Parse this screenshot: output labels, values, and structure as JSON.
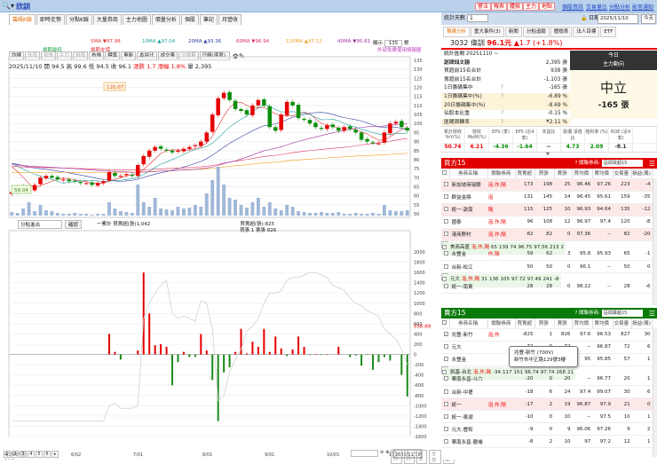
{
  "header": {
    "stock_name": "欣訓",
    "search_icon": "search-icon",
    "buttons": [
      "警法",
      "報表",
      "體檢",
      "主力",
      "地點"
    ],
    "links": [
      "個股資訊",
      "交易量比",
      "分點分析",
      "影音通知"
    ]
  },
  "left": {
    "tabs": [
      "籌碼K線",
      "即時走勢",
      "分點K線",
      "大量券商",
      "主力地圖",
      "價量分析",
      "個股",
      "筆記",
      "月營收"
    ],
    "ma": [
      {
        "label": "5MA ▼97.98",
        "color": "#e03030"
      },
      {
        "label": "10MA ▲97.04",
        "color": "#20a0a0"
      },
      {
        "label": "20MA ▲93.36",
        "color": "#3040a0"
      },
      {
        "label": "60MA ▼98.94",
        "color": "#e03060"
      },
      {
        "label": "120MA ▲97.12",
        "color": "#f0a020"
      },
      {
        "label": "40MA ▼95.61",
        "color": "#a030a0"
      }
    ],
    "ma2": [
      {
        "label": "楊期最低",
        "color": "#20a040"
      },
      {
        "label": "楊期支撐",
        "color": "#e03030"
      }
    ],
    "note": "外部免費使用情報圖",
    "toolbar": [
      "均線",
      "外資",
      "投信",
      "主力",
      "融資",
      "布林",
      "標準",
      "量能",
      "本益比",
      "成交量",
      "分價量"
    ],
    "toolbar_disabled": [
      1,
      2,
      3,
      4,
      10
    ],
    "period": "日線(還原)",
    "ohlc": {
      "date": "2025/11/10",
      "open": "開 94.5",
      "high": "高 99.6",
      "low": "低 94.5",
      "close": "收 96.1",
      "chg": "漲跌 1.7",
      "pct": "漲幅 1.8%",
      "vol": "量 2,395"
    },
    "zoom_label": "顯示",
    "zoom_value": "135",
    "zoom_unit": "根",
    "lower": {
      "select": "分點進出",
      "button": "確認",
      "cum_label": "一累計 買賣超(張)1,042",
      "net_label": "買賣超(張)-825",
      "bs_label": "買張 1 賣張 826",
      "last_value": "556.89"
    },
    "dates": [
      "4/28",
      "5/02",
      "6/02",
      "7/01",
      "8/01",
      "9/01",
      "10/01",
      "11/",
      "2025/11/10"
    ],
    "year": "2025",
    "pages": [
      "1",
      "2",
      "3",
      "4",
      "5",
      "6",
      "▸"
    ],
    "range_buttons": [
      "3月",
      "6月",
      "1年",
      "全部",
      "週期"
    ]
  },
  "chart_data": [
    {
      "type": "candlestick",
      "title": "",
      "ylim": [
        50,
        135
      ],
      "yticks": [
        50,
        55,
        60,
        65,
        70,
        75,
        80,
        85,
        90,
        95,
        100,
        105,
        110,
        115,
        120,
        125,
        130,
        135
      ],
      "annotations": {
        "max": "120.07",
        "min": "59.04"
      },
      "closes": [
        62,
        65,
        64,
        63,
        66,
        70,
        71,
        70,
        69,
        69,
        68,
        68,
        67,
        67,
        66,
        67,
        68,
        73,
        71,
        71,
        72,
        71,
        77,
        82,
        85,
        87,
        86,
        85,
        84,
        85,
        86,
        87,
        88,
        90,
        95,
        105,
        114,
        117,
        113,
        108,
        107,
        105,
        110,
        113,
        110,
        98,
        96,
        105,
        112,
        110,
        103,
        102,
        100,
        98,
        97,
        99,
        98,
        96,
        98,
        97,
        95,
        91,
        90,
        89,
        89,
        95,
        100,
        101,
        98,
        96.1
      ],
      "volume": [
        4,
        3,
        8,
        15,
        5,
        12,
        6,
        5,
        3,
        2,
        2,
        3,
        2,
        2,
        1,
        2,
        2,
        15,
        8,
        5,
        4,
        3,
        35,
        15,
        10,
        20,
        8,
        7,
        6,
        10,
        8,
        9,
        12,
        10,
        25,
        40,
        55,
        35,
        20,
        18,
        12,
        9,
        15,
        20,
        10,
        15,
        8,
        6,
        12,
        10,
        5,
        4,
        3,
        3,
        4,
        3,
        3,
        4,
        2,
        2,
        3,
        2,
        2,
        3,
        2,
        12,
        6,
        5,
        5,
        6
      ],
      "ma_periods": [
        5,
        10,
        20,
        60,
        120,
        40
      ]
    },
    {
      "type": "bar+line",
      "ylim": [
        -1600,
        2000
      ],
      "yticks": [
        -1600,
        -1400,
        -1200,
        -1000,
        -800,
        -600,
        -400,
        -200,
        0,
        200,
        400,
        600,
        800,
        1000,
        1200,
        1400,
        1600,
        1800,
        2000
      ],
      "net": [
        0,
        0,
        0,
        0,
        0,
        0,
        0,
        0,
        0,
        0,
        0,
        0,
        0,
        0,
        0,
        0,
        0,
        400,
        50,
        -100,
        0,
        0,
        80,
        1600,
        800,
        180,
        200,
        150,
        -600,
        -150,
        50,
        -50,
        -50,
        400,
        80,
        -500,
        -1300,
        -350,
        -250,
        50,
        500,
        20,
        250,
        150,
        500,
        50,
        350,
        120,
        -30,
        100,
        350,
        150,
        -10,
        10,
        -10,
        10,
        0,
        150,
        0,
        -50,
        -20,
        -220,
        -10,
        -300,
        -150,
        -50,
        -120,
        0,
        -400,
        -820
      ],
      "cumulative": [
        -1300,
        -1300,
        -1300,
        -1300,
        -1300,
        -1300,
        -1300,
        -1300,
        -1300,
        -1300,
        -1300,
        -1300,
        -1300,
        -1300,
        -1300,
        -1300,
        -1300,
        -1000,
        -950,
        -1050,
        -1050,
        -1050,
        -1000,
        700,
        1000,
        1200,
        1350,
        1450,
        800,
        700,
        750,
        700,
        650,
        1050,
        1000,
        500,
        -900,
        -800,
        -350,
        -100,
        100,
        450,
        550,
        700,
        1000,
        1200,
        1200,
        1250,
        1450,
        1500,
        1500,
        1550,
        1600,
        1600,
        1550,
        1500,
        1350,
        1300,
        1250,
        1100,
        1000,
        950,
        850,
        800,
        750,
        500,
        400,
        300,
        100,
        -200
      ]
    }
  ],
  "right": {
    "days_label": "統計天數",
    "days_value": "1",
    "date_label": "日期",
    "date_value": "2025/11/10",
    "today_button": "今天",
    "tabs": [
      "籌碼分析",
      "重大事件(3)",
      "新聞",
      "分點追蹤",
      "體檢表",
      "法人目標",
      "ETF"
    ],
    "quote": {
      "code_name": "3032 偉訓",
      "price": "96.1元",
      "change": "▲1.7 (+1.8%)"
    },
    "stats": [
      {
        "k": "統計區間  20251110 ~ 20251110",
        "v": ""
      },
      {
        "k": "區間成交量",
        "v": "2,395 張"
      },
      {
        "k": "買超前15名合計",
        "v": "938 張"
      },
      {
        "k": "賣超前15名合計",
        "v": "-1,103 張"
      },
      {
        "k": "1日籌碼集中",
        "q": "?",
        "v": "-165 張"
      },
      {
        "k": "1日籌碼集中(%)",
        "q": "?",
        "v": "-6.89 %",
        "y": true
      },
      {
        "k": "20日籌碼集中(%)",
        "v": "-8.69 %",
        "y": true
      },
      {
        "k": "佔股本比重",
        "q": "?",
        "v": "-0.15 %"
      },
      {
        "k": "區間周轉率",
        "q": "?",
        "v": "2.11 %",
        "y": true
      }
    ],
    "trend": {
      "title1": "今日",
      "title2": "主力動向",
      "state": "中立",
      "value": "-165 張"
    },
    "fin": [
      {
        "h": "累計營收 YoY(%)",
        "v": "50.74",
        "c": "#e00"
      },
      {
        "h": "營收 MoM(%)",
        "v": "6.21",
        "c": "#e00"
      },
      {
        "h": "EPS (季)",
        "v": "-4.36",
        "c": "#080"
      },
      {
        "h": "EPS (近4季)",
        "v": "-1.64",
        "c": "#080"
      },
      {
        "h": "本益比",
        "v": "--",
        "c": "#333"
      },
      {
        "h": "股價 淨值比",
        "v": "4.73",
        "c": "#080"
      },
      {
        "h": "殖利率 (%)",
        "v": "2.09",
        "c": "#080"
      },
      {
        "h": "ROE (近4季)",
        "v": "-8.1",
        "c": "#333"
      },
      {
        "h": "",
        "v": "",
        "c": "#333"
      }
    ],
    "columns": [
      "券商名稱",
      "關聯券商",
      "買賣超",
      "買張",
      "賣張",
      "買均價",
      "賣均價",
      "交易量",
      "損益(萬)"
    ],
    "buy": {
      "title": "買方15",
      "filter_label": "? 關聯券商:",
      "filter": "區間買超15",
      "color": "#e00000",
      "rows": [
        [
          "新加坡商瑞銀",
          "泡,作,隔",
          "173",
          "198",
          "25",
          "96.46",
          "97.26",
          "223",
          "-4",
          "pr"
        ],
        [
          "群益金鼎",
          "泡",
          "131",
          "145",
          "14",
          "96.45",
          "95.61",
          "159",
          "-35",
          ""
        ],
        [
          "統一-敦南",
          "隔",
          "115",
          "125",
          "10",
          "96.93",
          "94.64",
          "135",
          "-12",
          "pr"
        ],
        [
          "國泰",
          "泡,作,隔",
          "96",
          "108",
          "12",
          "96.97",
          "97.4",
          "120",
          "-8",
          ""
        ],
        [
          "港商野村",
          "泡,作,隔",
          "82",
          "82",
          "0",
          "97.36",
          "--",
          "82",
          "-20",
          "pr"
        ],
        [
          "美商高盛",
          "泡,作,隔",
          "65",
          "139",
          "74",
          "96.75",
          "97.56",
          "213",
          "2",
          "pg"
        ],
        [
          "永豐金",
          "作,隔",
          "59",
          "62",
          "3",
          "95.8",
          "95.93",
          "65",
          "-1",
          ""
        ],
        [
          "台新-松江",
          "",
          "50",
          "50",
          "0",
          "96.1",
          "--",
          "50",
          "0",
          ""
        ],
        [
          "元大",
          "泡,作,隔",
          "31",
          "136",
          "105",
          "97.72",
          "97.49",
          "241",
          "-8",
          "pg"
        ],
        [
          "統一-南東",
          "",
          "28",
          "28",
          "0",
          "98.22",
          "--",
          "28",
          "-6",
          ""
        ]
      ]
    },
    "sell": {
      "title": "賣方15",
      "filter_label": "? 關聯券商:",
      "filter": "區間賣超15",
      "color": "#0a7a0a",
      "rows": [
        [
          "兆豐-新竹",
          "泡,作",
          "-825",
          "1",
          "826",
          "97.6",
          "96.53",
          "827",
          "30",
          ""
        ],
        [
          "元大",
          "",
          "-72",
          "0",
          "72",
          "--",
          "96.87",
          "72",
          "6",
          ""
        ],
        [
          "永豐金",
          "",
          "-55",
          "1",
          "56",
          "95",
          "95.85",
          "57",
          "1",
          ""
        ],
        [
          "凱基-台北",
          "泡,作,隔",
          "-34",
          "117",
          "151",
          "96.74",
          "97.74",
          "268",
          "21",
          "pg"
        ],
        [
          "華南永昌-斗六",
          "",
          "-20",
          "0",
          "20",
          "--",
          "96.77",
          "20",
          "1",
          ""
        ],
        [
          "台新-中壢",
          "",
          "-18",
          "6",
          "24",
          "97.4",
          "99.07",
          "30",
          "6",
          ""
        ],
        [
          "統一",
          "泡,作,隔",
          "-17",
          "2",
          "19",
          "96.87",
          "97.9",
          "21",
          "0",
          "pr"
        ],
        [
          "統一-東湖",
          "",
          "-10",
          "0",
          "10",
          "--",
          "97.5",
          "10",
          "1",
          ""
        ],
        [
          "元大-豐和",
          "",
          "-9",
          "0",
          "9",
          "96.06",
          "97.26",
          "9",
          "2",
          ""
        ],
        [
          "華南永昌-鹽埔",
          "",
          "-8",
          "2",
          "10",
          "97",
          "97.2",
          "12",
          "1",
          ""
        ]
      ],
      "tooltip": [
        "兆豐-新竹 (700V)",
        "新竹市中正路129號3樓"
      ]
    }
  }
}
